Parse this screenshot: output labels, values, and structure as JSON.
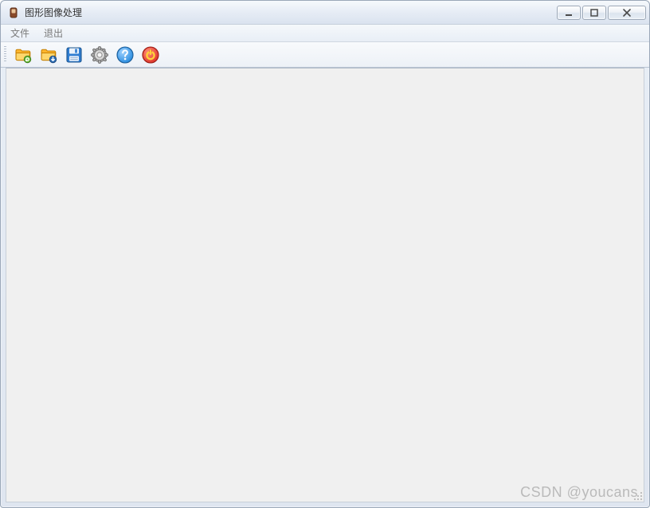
{
  "window": {
    "title": "图形图像处理"
  },
  "menubar": {
    "items": [
      {
        "label": "文件"
      },
      {
        "label": "退出"
      }
    ]
  },
  "toolbar": {
    "buttons": [
      {
        "name": "open-folder-icon"
      },
      {
        "name": "import-folder-icon"
      },
      {
        "name": "save-icon"
      },
      {
        "name": "settings-icon"
      },
      {
        "name": "help-icon"
      },
      {
        "name": "power-icon"
      }
    ]
  },
  "watermark": "CSDN @youcans"
}
